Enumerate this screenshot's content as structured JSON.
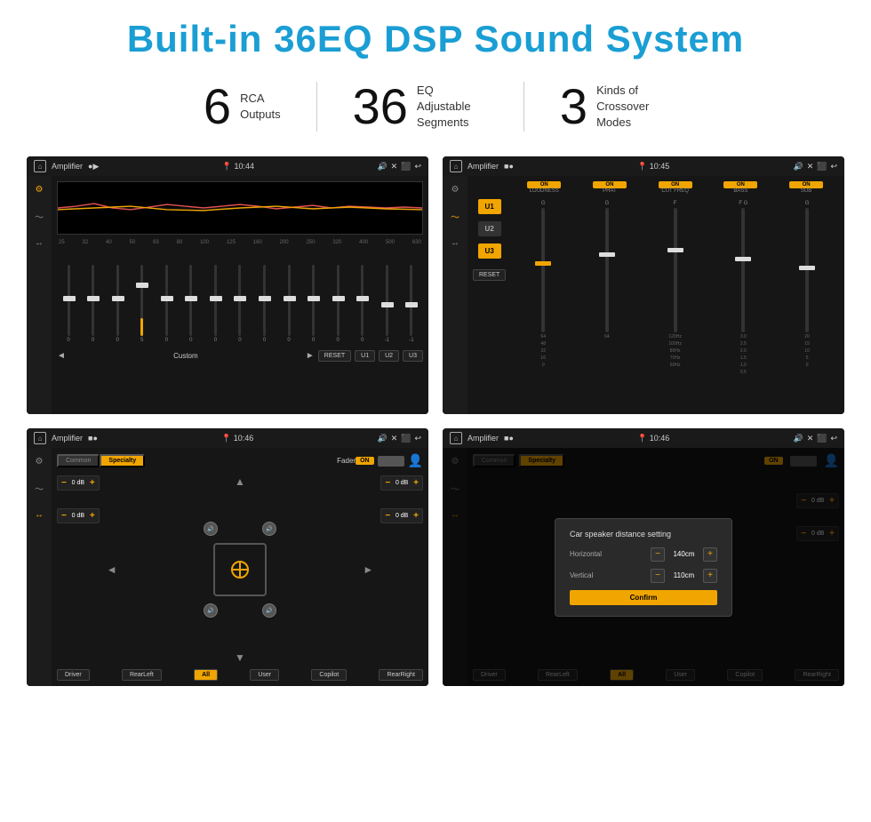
{
  "header": {
    "title": "Built-in 36EQ DSP Sound System"
  },
  "stats": [
    {
      "number": "6",
      "label": "RCA\nOutputs"
    },
    {
      "number": "36",
      "label": "EQ Adjustable\nSegments"
    },
    {
      "number": "3",
      "label": "Kinds of\nCrossover Modes"
    }
  ],
  "screens": [
    {
      "id": "eq-screen",
      "topbar": {
        "title": "Amplifier",
        "time": "10:44"
      },
      "type": "eq"
    },
    {
      "id": "crossover-screen",
      "topbar": {
        "title": "Amplifier",
        "time": "10:45"
      },
      "type": "crossover"
    },
    {
      "id": "fader-screen",
      "topbar": {
        "title": "Amplifier",
        "time": "10:46"
      },
      "type": "fader"
    },
    {
      "id": "distance-screen",
      "topbar": {
        "title": "Amplifier",
        "time": "10:46"
      },
      "type": "distance",
      "dialog": {
        "title": "Car speaker distance setting",
        "horizontal_label": "Horizontal",
        "horizontal_value": "140cm",
        "vertical_label": "Vertical",
        "vertical_value": "110cm",
        "confirm_label": "Confirm"
      }
    }
  ],
  "eq": {
    "freqs": [
      "25",
      "32",
      "40",
      "50",
      "63",
      "80",
      "100",
      "125",
      "160",
      "200",
      "250",
      "320",
      "400",
      "500",
      "630"
    ],
    "values": [
      "0",
      "0",
      "0",
      "5",
      "0",
      "0",
      "0",
      "0",
      "0",
      "0",
      "0",
      "0",
      "0",
      "-1",
      "-1"
    ],
    "controls": {
      "prev": "◄",
      "label": "Custom",
      "next": "►",
      "reset": "RESET",
      "u1": "U1",
      "u2": "U2",
      "u3": "U3"
    }
  },
  "crossover": {
    "presets": [
      "U1",
      "U2",
      "U3"
    ],
    "channels": [
      "LOUDNESS",
      "PHAT",
      "CUT FREQ",
      "BASS",
      "SUB"
    ]
  },
  "fader": {
    "tabs": [
      "Common",
      "Specialty"
    ],
    "fader_label": "Fader",
    "on_label": "ON",
    "volume_values": [
      "0 dB",
      "0 dB",
      "0 dB",
      "0 dB"
    ],
    "bottom_buttons": [
      "Driver",
      "RearLeft",
      "All",
      "User",
      "Copilot",
      "RearRight"
    ]
  },
  "distance_screen": {
    "tabs": [
      "Common",
      "Specialty"
    ],
    "on_label": "ON",
    "dialog": {
      "title": "Car speaker distance setting",
      "horizontal_label": "Horizontal",
      "horizontal_value": "140cm",
      "vertical_label": "Vertical",
      "vertical_value": "110cm",
      "confirm_label": "Confirm"
    },
    "right_values": [
      "0 dB",
      "0 dB"
    ],
    "bottom_buttons": [
      "Driver",
      "RearLeft",
      "All",
      "User",
      "Copilot",
      "RearRight"
    ]
  }
}
